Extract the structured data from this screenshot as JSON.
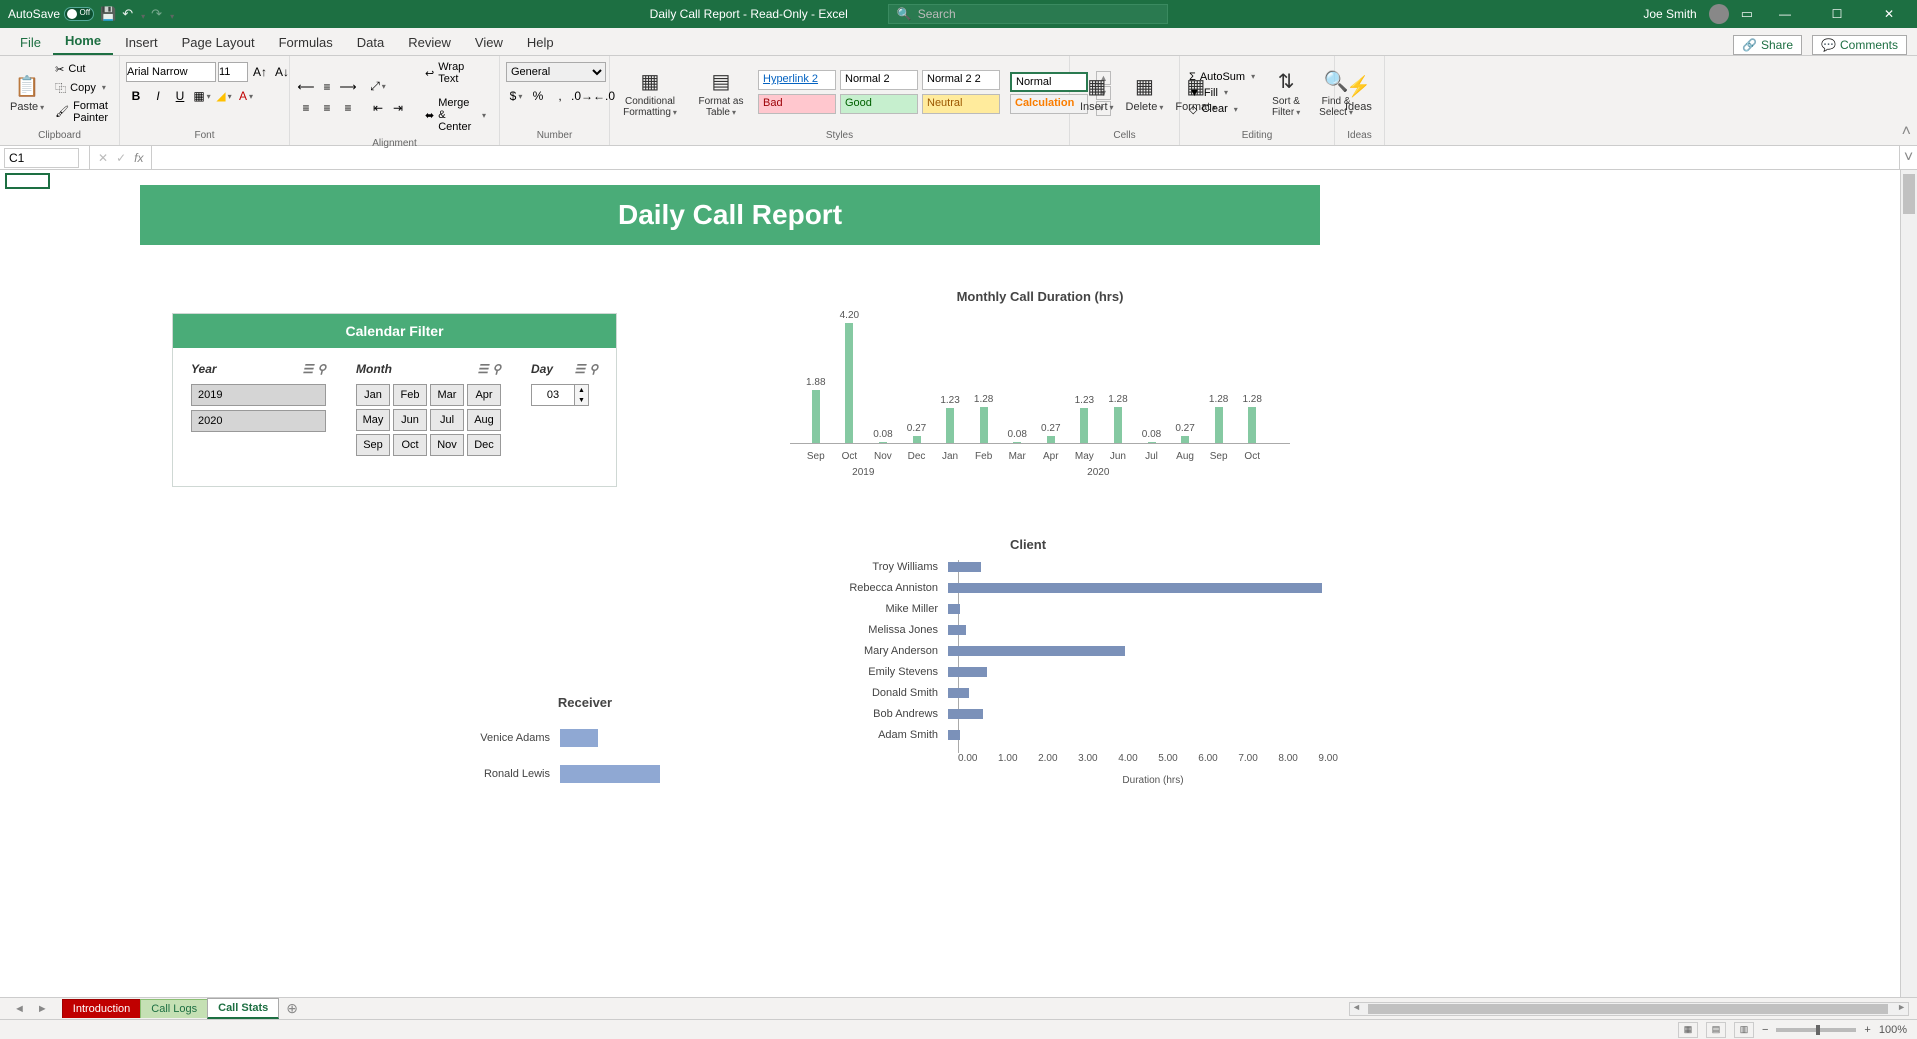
{
  "titlebar": {
    "autosave_label": "AutoSave",
    "autosave_state": "Off",
    "doc_title": "Daily Call Report - Read-Only - Excel",
    "search_placeholder": "Search",
    "user": "Joe Smith"
  },
  "tabs": {
    "file": "File",
    "home": "Home",
    "insert": "Insert",
    "page_layout": "Page Layout",
    "formulas": "Formulas",
    "data": "Data",
    "review": "Review",
    "view": "View",
    "help": "Help",
    "share": "Share",
    "comments": "Comments"
  },
  "ribbon": {
    "clipboard": {
      "label": "Clipboard",
      "paste": "Paste",
      "cut": "Cut",
      "copy": "Copy",
      "painter": "Format Painter"
    },
    "font": {
      "label": "Font",
      "family": "Arial Narrow",
      "size": "11"
    },
    "alignment": {
      "label": "Alignment",
      "wrap": "Wrap Text",
      "merge": "Merge & Center"
    },
    "number": {
      "label": "Number",
      "format": "General"
    },
    "styles": {
      "label": "Styles",
      "cond": "Conditional Formatting",
      "table": "Format as Table",
      "s1": "Hyperlink 2",
      "s2": "Normal 2",
      "s3": "Normal 2 2",
      "s4": "Normal",
      "s5": "Bad",
      "s6": "Good",
      "s7": "Neutral",
      "s8": "Calculation"
    },
    "cells": {
      "label": "Cells",
      "insert": "Insert",
      "delete": "Delete",
      "format": "Format"
    },
    "editing": {
      "label": "Editing",
      "autosum": "AutoSum",
      "fill": "Fill",
      "clear": "Clear",
      "sort": "Sort & Filter",
      "find": "Find & Select"
    },
    "ideas": {
      "label": "Ideas",
      "btn": "Ideas"
    }
  },
  "namebox": "C1",
  "report": {
    "title": "Daily Call Report",
    "filter": {
      "header": "Calendar Filter",
      "year_label": "Year",
      "month_label": "Month",
      "day_label": "Day",
      "years": [
        "2019",
        "2020"
      ],
      "months": [
        "Jan",
        "Feb",
        "Mar",
        "Apr",
        "May",
        "Jun",
        "Jul",
        "Aug",
        "Sep",
        "Oct",
        "Nov",
        "Dec"
      ],
      "day_value": "03"
    }
  },
  "chart_data": [
    {
      "id": "monthly",
      "type": "bar",
      "title": "Monthly Call Duration (hrs)",
      "categories": [
        "Sep",
        "Oct",
        "Nov",
        "Dec",
        "Jan",
        "Feb",
        "Mar",
        "Apr",
        "May",
        "Jun",
        "Jul",
        "Aug",
        "Sep",
        "Oct"
      ],
      "year_groups": {
        "2019": [
          0,
          1,
          2,
          3
        ],
        "2020": [
          4,
          5,
          6,
          7,
          8,
          9,
          10,
          11,
          12,
          13
        ]
      },
      "values": [
        1.88,
        4.2,
        0.08,
        0.27,
        1.23,
        1.28,
        0.08,
        0.27,
        1.23,
        1.28,
        0.08,
        0.27,
        1.28,
        1.28
      ],
      "ylim": [
        0,
        4.5
      ]
    },
    {
      "id": "client",
      "type": "bar-horizontal",
      "title": "Client",
      "xlabel": "Duration (hrs)",
      "categories": [
        "Troy Williams",
        "Rebecca Anniston",
        "Mike Miller",
        "Melissa Jones",
        "Mary Anderson",
        "Emily Stevens",
        "Donald Smith",
        "Bob Andrews",
        "Adam Smith"
      ],
      "values": [
        0.8,
        9.1,
        0.3,
        0.45,
        4.3,
        0.95,
        0.5,
        0.85,
        0.3
      ],
      "xlim": [
        0,
        9.5
      ],
      "xticks": [
        "0.00",
        "1.00",
        "2.00",
        "3.00",
        "4.00",
        "5.00",
        "6.00",
        "7.00",
        "8.00",
        "9.00"
      ]
    },
    {
      "id": "receiver",
      "type": "bar-horizontal",
      "title": "Receiver",
      "categories": [
        "Venice Adams",
        "Ronald Lewis"
      ],
      "values": [
        1.5,
        4.0
      ],
      "xlim": [
        0,
        10
      ]
    }
  ],
  "sheets": {
    "introduction": "Introduction",
    "call_logs": "Call Logs",
    "call_stats": "Call Stats"
  },
  "status": {
    "zoom": "100%"
  }
}
